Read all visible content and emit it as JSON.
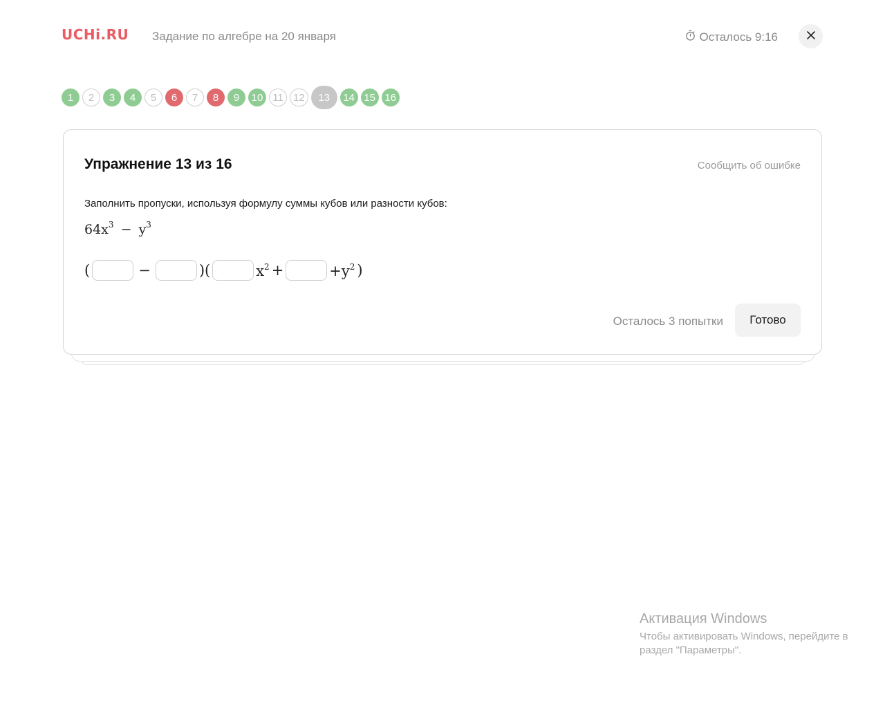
{
  "header": {
    "logo": "UCHi.RU",
    "task_title": "Задание по алгебре на 20 января",
    "timer_label": "Осталось 9:16"
  },
  "progress": {
    "items": [
      {
        "label": "1",
        "state": "green"
      },
      {
        "label": "2",
        "state": "empty"
      },
      {
        "label": "3",
        "state": "green"
      },
      {
        "label": "4",
        "state": "green"
      },
      {
        "label": "5",
        "state": "empty"
      },
      {
        "label": "6",
        "state": "red"
      },
      {
        "label": "7",
        "state": "empty"
      },
      {
        "label": "8",
        "state": "red"
      },
      {
        "label": "9",
        "state": "green"
      },
      {
        "label": "10",
        "state": "green"
      },
      {
        "label": "11",
        "state": "empty"
      },
      {
        "label": "12",
        "state": "empty"
      },
      {
        "label": "13",
        "state": "current"
      },
      {
        "label": "14",
        "state": "green"
      },
      {
        "label": "15",
        "state": "green"
      },
      {
        "label": "16",
        "state": "green"
      }
    ]
  },
  "exercise": {
    "title": "Упражнение 13 из 16",
    "report_link": "Сообщить об ошибке",
    "instruction": "Заполнить пропуски, используя формулу суммы кубов или разности кубов:",
    "expression": {
      "coef": "64x",
      "exp1": "3",
      "minus": "−",
      "var": "y",
      "exp2": "3"
    },
    "answer": {
      "open1": "(",
      "minus": "−",
      "close_open": ")(",
      "x": "x",
      "x_exp": "2",
      "plus": "+",
      "plus_y": "+y",
      "y_exp": "2",
      "close": ")"
    },
    "attempts_text": "Осталось 3 попытки",
    "done_label": "Готово"
  },
  "watermark": {
    "title": "Активация Windows",
    "line1": "Чтобы активировать Windows, перейдите в",
    "line2": "раздел \"Параметры\"."
  },
  "colors": {
    "brand": "#ea5b63",
    "correct": "#8fcc93",
    "wrong": "#e06a6d",
    "current": "#c7c7c7"
  }
}
